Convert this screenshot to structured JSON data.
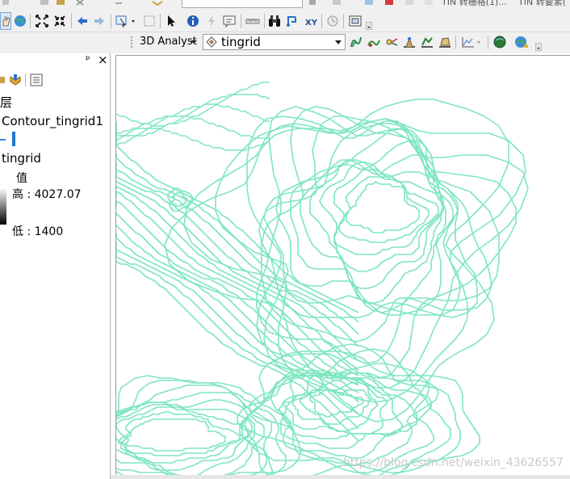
{
  "toolbar": {
    "window_title_1": "TIN 转栅格(1)...",
    "window_title_2": "TIN 转要素(",
    "analyst_label": "3D Analyst",
    "layer_select_value": "tingrid"
  },
  "toc": {
    "header_text": "层",
    "pin_glyph": "ᵖ",
    "close_glyph": "×",
    "layer1_name": "Contour_tingrid1",
    "layer2_name": "tingrid",
    "value_label": "值",
    "high_label": "高 : 4027.07",
    "low_label": "低 : 1400"
  },
  "map": {
    "contour_color": "#7ee6bf",
    "watermark": "https://blog.csdn.net/weixin_43626557"
  }
}
